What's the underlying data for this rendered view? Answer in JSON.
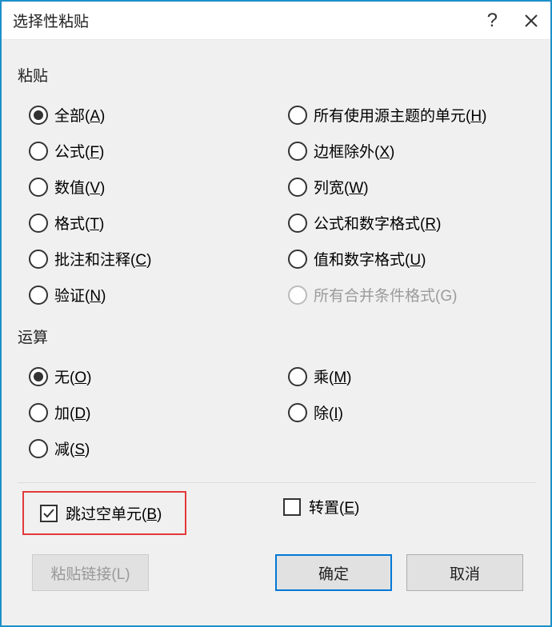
{
  "title": "选择性粘贴",
  "help_symbol": "?",
  "sections": {
    "paste_label": "粘贴",
    "operation_label": "运算"
  },
  "paste": {
    "left": [
      {
        "text": "全部(",
        "key": "A",
        "after": ")",
        "selected": true
      },
      {
        "text": "公式(",
        "key": "F",
        "after": ")",
        "selected": false
      },
      {
        "text": "数值(",
        "key": "V",
        "after": ")",
        "selected": false
      },
      {
        "text": "格式(",
        "key": "T",
        "after": ")",
        "selected": false
      },
      {
        "text": "批注和注释(",
        "key": "C",
        "after": ")",
        "selected": false
      },
      {
        "text": "验证(",
        "key": "N",
        "after": ")",
        "selected": false
      }
    ],
    "right": [
      {
        "text": "所有使用源主题的单元(",
        "key": "H",
        "after": ")",
        "selected": false
      },
      {
        "text": "边框除外(",
        "key": "X",
        "after": ")",
        "selected": false
      },
      {
        "text": "列宽(",
        "key": "W",
        "after": ")",
        "selected": false
      },
      {
        "text": "公式和数字格式(",
        "key": "R",
        "after": ")",
        "selected": false
      },
      {
        "text": "值和数字格式(",
        "key": "U",
        "after": ")",
        "selected": false
      },
      {
        "text": "所有合并条件格式(G)",
        "key": "",
        "after": "",
        "selected": false,
        "disabled": true
      }
    ]
  },
  "operation": {
    "left": [
      {
        "text": "无(",
        "key": "O",
        "after": ")",
        "selected": true
      },
      {
        "text": "加(",
        "key": "D",
        "after": ")",
        "selected": false
      },
      {
        "text": "减(",
        "key": "S",
        "after": ")",
        "selected": false
      }
    ],
    "right": [
      {
        "text": "乘(",
        "key": "M",
        "after": ")",
        "selected": false
      },
      {
        "text": "除(",
        "key": "I",
        "after": ")",
        "selected": false
      }
    ]
  },
  "checks": {
    "skip_blanks": {
      "text": "跳过空单元(",
      "key": "B",
      "after": ")",
      "checked": true
    },
    "transpose": {
      "text": "转置(",
      "key": "E",
      "after": ")",
      "checked": false
    }
  },
  "buttons": {
    "paste_link": "粘贴链接(L)",
    "ok": "确定",
    "cancel": "取消"
  }
}
